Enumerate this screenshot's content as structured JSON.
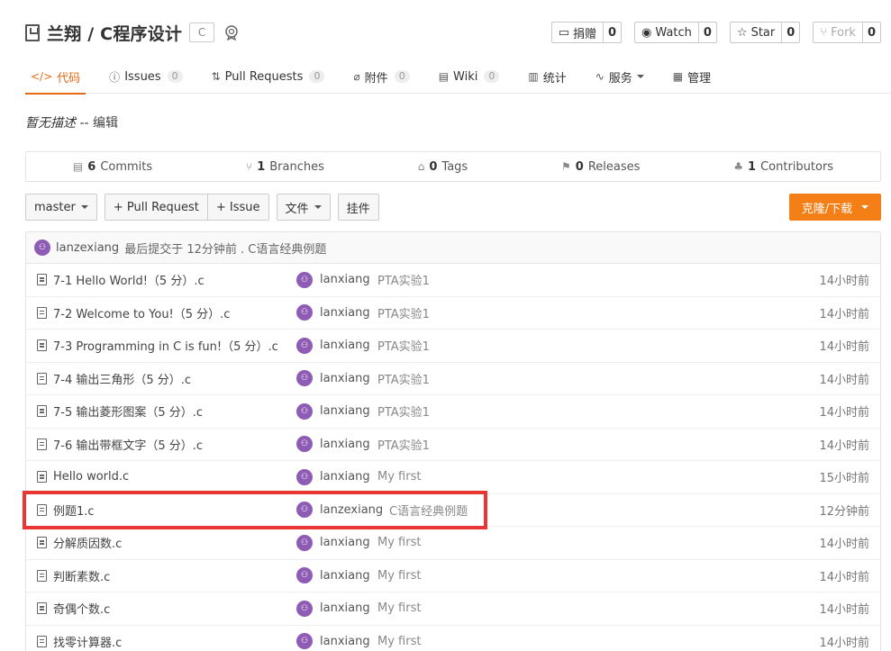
{
  "repo": {
    "title": "兰翔 / C程序设计",
    "lang_badge": "C"
  },
  "actions": [
    {
      "icon": "donate-icon",
      "label": "捐赠",
      "count": "0",
      "disabled": false
    },
    {
      "icon": "eye-icon",
      "label": "Watch",
      "count": "0",
      "disabled": false
    },
    {
      "icon": "star-icon",
      "label": "Star",
      "count": "0",
      "disabled": false
    },
    {
      "icon": "fork-icon",
      "label": "Fork",
      "count": "0",
      "disabled": true
    }
  ],
  "tabs": [
    {
      "icon": "</>",
      "label": "代码",
      "badge": null,
      "active": true
    },
    {
      "icon": "ⓘ",
      "label": "Issues",
      "badge": "0",
      "active": false
    },
    {
      "icon": "⇅",
      "label": "Pull Requests",
      "badge": "0",
      "active": false
    },
    {
      "icon": "⌀",
      "label": "附件",
      "badge": "0",
      "active": false
    },
    {
      "icon": "▤",
      "label": "Wiki",
      "badge": "0",
      "active": false
    },
    {
      "icon": "▥",
      "label": "统计",
      "badge": null,
      "active": false
    },
    {
      "icon": "∿",
      "label": "服务",
      "badge": null,
      "active": false,
      "dropdown": true
    },
    {
      "icon": "▦",
      "label": "管理",
      "badge": null,
      "active": false
    }
  ],
  "description": {
    "text": "暂无描述",
    "separator": " -- ",
    "edit_link": "编辑"
  },
  "stats": [
    {
      "icon": "commits-icon",
      "count": "6",
      "label": "Commits"
    },
    {
      "icon": "branch-icon",
      "count": "1",
      "label": "Branches"
    },
    {
      "icon": "tag-icon",
      "count": "0",
      "label": "Tags"
    },
    {
      "icon": "release-icon",
      "count": "0",
      "label": "Releases"
    },
    {
      "icon": "contributors-icon",
      "count": "1",
      "label": "Contributors"
    }
  ],
  "toolbar": {
    "branch": "master",
    "pull_request": "+ Pull Request",
    "issue": "+ Issue",
    "file": "文件",
    "widget": "挂件",
    "clone": "克隆/下载"
  },
  "last_commit": {
    "user": "lanzexiang",
    "text": "最后提交于 12分钟前 . C语言经典例题"
  },
  "files": [
    {
      "name": "7-1 Hello World!（5 分）.c",
      "author": "lanxiang",
      "message": "PTA实验1",
      "time": "14小时前"
    },
    {
      "name": "7-2 Welcome to You!（5 分）.c",
      "author": "lanxiang",
      "message": "PTA实验1",
      "time": "14小时前"
    },
    {
      "name": "7-3 Programming in C is fun!（5 分）.c",
      "author": "lanxiang",
      "message": "PTA实验1",
      "time": "14小时前"
    },
    {
      "name": "7-4 输出三角形（5 分）.c",
      "author": "lanxiang",
      "message": "PTA实验1",
      "time": "14小时前"
    },
    {
      "name": "7-5 输出菱形图案（5 分）.c",
      "author": "lanxiang",
      "message": "PTA实验1",
      "time": "14小时前"
    },
    {
      "name": "7-6 输出带框文字（5 分）.c",
      "author": "lanxiang",
      "message": "PTA实验1",
      "time": "14小时前"
    },
    {
      "name": "Hello world.c",
      "author": "lanxiang",
      "message": "My first",
      "time": "15小时前"
    },
    {
      "name": "例题1.c",
      "author": "lanzexiang",
      "message": "C语言经典例题",
      "time": "12分钟前"
    },
    {
      "name": "分解质因数.c",
      "author": "lanxiang",
      "message": "My first",
      "time": "14小时前"
    },
    {
      "name": "判断素数.c",
      "author": "lanxiang",
      "message": "My first",
      "time": "14小时前"
    },
    {
      "name": "奇偶个数.c",
      "author": "lanxiang",
      "message": "My first",
      "time": "14小时前"
    },
    {
      "name": "找零计算器.c",
      "author": "lanxiang",
      "message": "My first",
      "time": "14小时前"
    }
  ],
  "colors": {
    "accent": "#e66a15",
    "clone_button": "#f57f17",
    "avatar": "#8e5bb5",
    "highlight": "#ea3535"
  }
}
